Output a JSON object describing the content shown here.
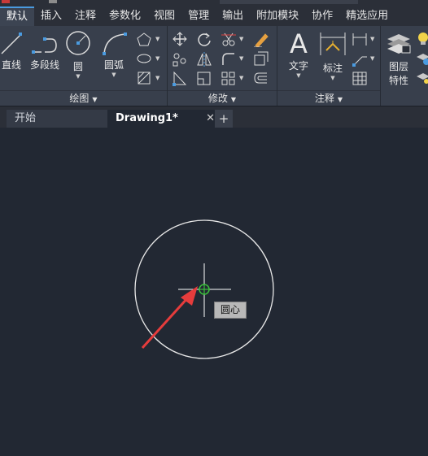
{
  "menu": [
    "默认",
    "插入",
    "注释",
    "参数化",
    "视图",
    "管理",
    "输出",
    "附加模块",
    "协作",
    "精选应用"
  ],
  "ribbon": {
    "draw": {
      "title": "绘图",
      "line": "直线",
      "polyline": "多段线",
      "circle": "圆",
      "arc": "圆弧"
    },
    "modify": {
      "title": "修改"
    },
    "annotation": {
      "title": "注释",
      "text": "文字",
      "dimension": "标注"
    },
    "layers": {
      "label1": "图层",
      "label2": "特性"
    }
  },
  "tabs": {
    "start": "开始",
    "drawing": "Drawing1*",
    "close": "✕",
    "add": "+"
  },
  "canvas": {
    "tooltip": "圆心"
  },
  "colors": {
    "accent": "#4a9be0",
    "background": "#222833",
    "snap_marker": "#3bbf3b",
    "arrow": "#e63c3c"
  }
}
